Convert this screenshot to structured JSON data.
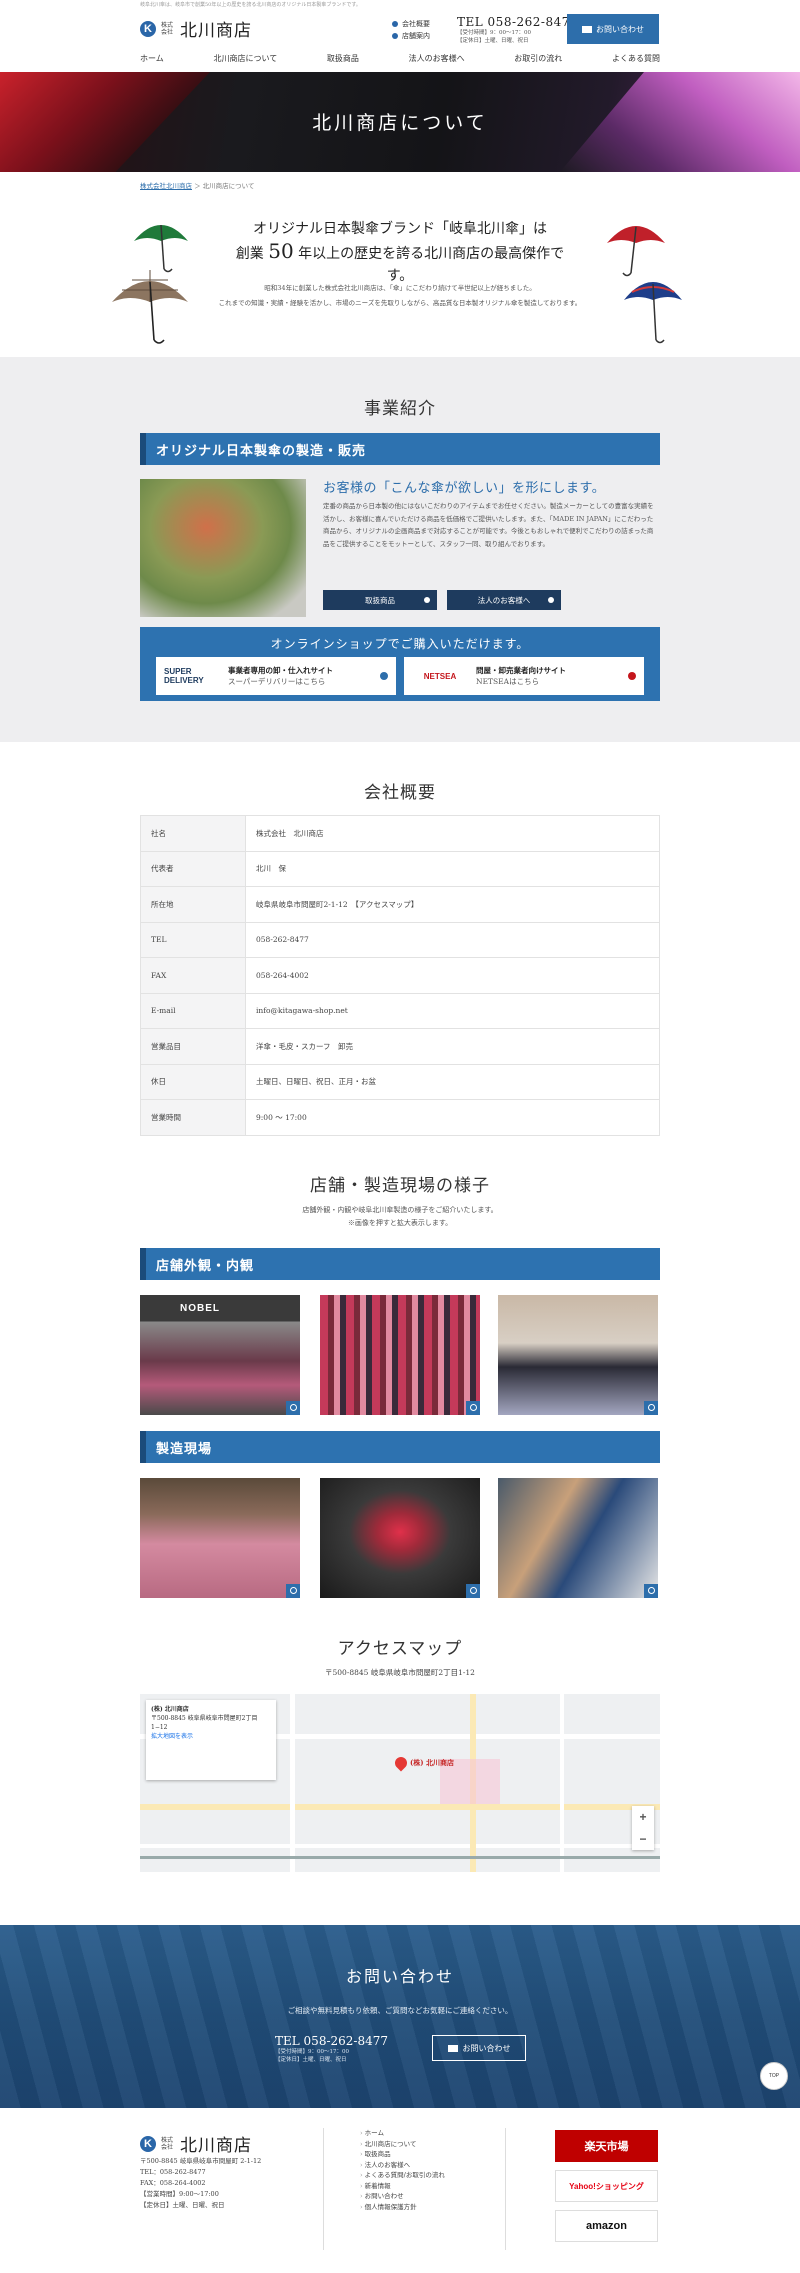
{
  "header": {
    "note": "岐阜北川傘は、岐阜市で創業50年以上の歴史を誇る北川商店のオリジナル日本製傘ブランドです。",
    "logo_small": "株式会社",
    "logo_name": "北川商店",
    "links": [
      "会社概要",
      "店舗案内"
    ],
    "tel": "TEL 058-262-8477",
    "hours1": "【受付時間】9：00～17：00",
    "hours2": "【定休日】土曜、日曜、祝日",
    "contact_btn": "お問い合わせ"
  },
  "nav": [
    "ホーム",
    "北川商店について",
    "取扱商品",
    "法人のお客様へ",
    "お取引の流れ",
    "よくある質問"
  ],
  "hero": {
    "title": "北川商店について"
  },
  "breadcrumb": {
    "home": "株式会社北川商店",
    "sep": "＞",
    "current": "北川商店について"
  },
  "intro": {
    "line1": "オリジナル日本製傘ブランド「岐阜北川傘」は",
    "line2a": "創業",
    "years": "50",
    "line2b": "年以上の歴史を誇る北川商店の最高傑作です。",
    "p1": "昭和34年に創業した株式会社北川商店は、「傘」にこだわり続けて半世紀以上が経ちました。",
    "p2": "これまでの知識・実績・経験を活かし、市場のニーズを先取りしながら、高品質な日本製オリジナル傘を製造しております。"
  },
  "business": {
    "title": "事業紹介",
    "bar": "オリジナル日本製傘の製造・販売",
    "heading": "お客様の「こんな傘が欲しい」を形にします。",
    "body": "定番の商品から日本製の他にはないこだわりのアイテムまでお任せください。製造メーカーとしての豊富な実績を活かし、お客様に喜んでいただける商品を低価格でご提供いたします。また、「MADE IN JAPAN」にこだわった商品から、オリジナルの企画商品まで対応することが可能です。今後ともおしゃれで便利でこだわりの詰まった商品をご提供することをモットーとして、スタッフ一同、取り組んでおります。",
    "btn1": "取扱商品",
    "btn2": "法人のお客様へ",
    "shop_heading": "オンラインショップでご購入いただけます。",
    "shop1_logo": "SUPER DELIVERY",
    "shop1_line1": "事業者専用の卸・仕入れサイト",
    "shop1_line2": "スーパーデリバリーはこちら",
    "shop2_logo": "NETSEA",
    "shop2_line1": "問屋・卸売業者向けサイト",
    "shop2_line2": "NETSEAはこちら"
  },
  "company": {
    "title": "会社概要",
    "rows": [
      {
        "k": "社名",
        "v": "株式会社　北川商店"
      },
      {
        "k": "代表者",
        "v": "北川　保"
      },
      {
        "k": "所在地",
        "v": "岐阜県岐阜市問屋町2-1-12　【アクセスマップ】"
      },
      {
        "k": "TEL",
        "v": "058-262-8477"
      },
      {
        "k": "FAX",
        "v": "058-264-4002"
      },
      {
        "k": "E-mail",
        "v": "info@kitagawa-shop.net"
      },
      {
        "k": "営業品目",
        "v": "洋傘・毛皮・スカーフ　卸売"
      },
      {
        "k": "休日",
        "v": "土曜日、日曜日、祝日、正月・お盆"
      },
      {
        "k": "営業時間",
        "v": "9:00 ～ 17:00"
      }
    ]
  },
  "store": {
    "title": "店舗・製造現場の様子",
    "sub1": "店舗外観・内観や岐阜北川傘製造の様子をご紹介いたします。",
    "sub2": "※画像を押すと拡大表示します。",
    "bar1": "店舗外観・内観",
    "bar2": "製造現場",
    "sign": "NOBEL"
  },
  "access": {
    "title": "アクセスマップ",
    "address": "〒500-8845 岐阜県岐阜市問屋町2丁目1-12",
    "map_name": "(株) 北川商店",
    "map_addr": "〒500-8845 岐阜県岐阜市問屋町2丁目1−12",
    "map_link": "拡大地図を表示",
    "pin_label": "(株) 北川商店"
  },
  "contact": {
    "title": "お問い合わせ",
    "sub": "ご相談や無料見積もり依頼、ご質問などお気軽にご連絡ください。",
    "tel": "TEL 058-262-8477",
    "hours1": "【受付時間】9：00～17：00",
    "hours2": "【定休日】土曜、日曜、祝日",
    "btn": "お問い合わせ",
    "totop": "TOP"
  },
  "footer": {
    "logo_small": "株式会社",
    "logo_name": "北川商店",
    "addr": [
      "〒500-8845 岐阜県岐阜市問屋町 2-1-12",
      "TEL：058-262-8477",
      "FAX：058-264-4002",
      "【営業時間】9:00～17:00",
      "【定休日】土曜、日曜、祝日"
    ],
    "links": [
      "ホーム",
      "北川商店について",
      "取扱商品",
      "法人のお客様へ",
      "よくある質問/お取引の流れ",
      "新着情報",
      "お問い合わせ",
      "個人情報保護方針"
    ],
    "banner1": "楽天市場",
    "banner2": "Yahoo!ショッピング",
    "banner3": "amazon"
  },
  "colors": {
    "brand_blue": "#2d72b0",
    "navy": "#1e3b5e",
    "rakuten_red": "#bf0000"
  }
}
